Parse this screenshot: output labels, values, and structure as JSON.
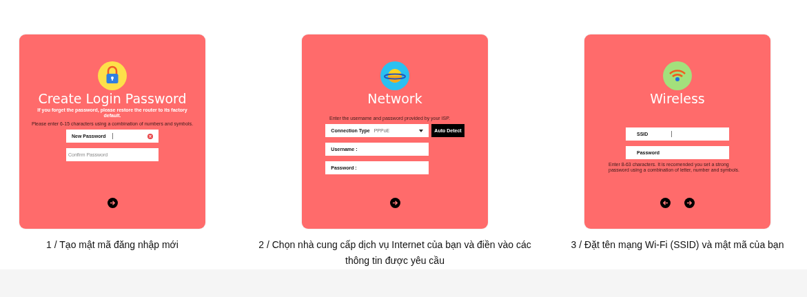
{
  "steps": [
    {
      "card": {
        "kind": "password",
        "title": "Create Login Password",
        "subtitle": "If you forget the password, please restore the router to its factory default.",
        "hint_top": "Please enter 6-15 characters using a combination of numbers and symbols.",
        "fields": [
          {
            "kind": "text",
            "label": "New Password",
            "focused": true,
            "clear_button": true
          },
          {
            "kind": "text",
            "placeholder": "Confirm Password",
            "focused": false,
            "clear_button": false
          }
        ],
        "nav": [
          {
            "kind": "next"
          }
        ]
      },
      "caption": "1 / Tạo mật mã đăng nhập mới"
    },
    {
      "card": {
        "kind": "network",
        "title": "Network",
        "hint_top": "Enter the username and password provided by your ISP.",
        "fields": [
          {
            "kind": "select",
            "label": "Connection Type",
            "value": "PPPoE",
            "focused": false,
            "clear_button": false,
            "button": "Auto Detect"
          },
          {
            "kind": "text",
            "label": "Username :",
            "focused": false,
            "clear_button": false
          },
          {
            "kind": "text",
            "label": "Password :",
            "focused": false,
            "clear_button": false
          }
        ],
        "nav": [
          {
            "kind": "next"
          }
        ]
      },
      "caption": "2 / Chọn nhà cung cấp dịch vụ Internet của bạn và điền vào các thông tin được yêu cầu"
    },
    {
      "card": {
        "kind": "wireless",
        "title": "Wireless",
        "fields": [
          {
            "kind": "text",
            "label": "SSID",
            "focused": true,
            "clear_button": false
          },
          {
            "kind": "text",
            "label": "Password",
            "focused": false,
            "clear_button": false
          }
        ],
        "hint_bottom": "Enter 8-63 characters. It is recomended you set a strong password using a combination of letter, number and symbols.",
        "nav": [
          {
            "kind": "back"
          },
          {
            "kind": "next"
          }
        ]
      },
      "caption": "3 / Đặt tên mạng Wi-Fi (SSID) và mật mã của bạn"
    }
  ]
}
